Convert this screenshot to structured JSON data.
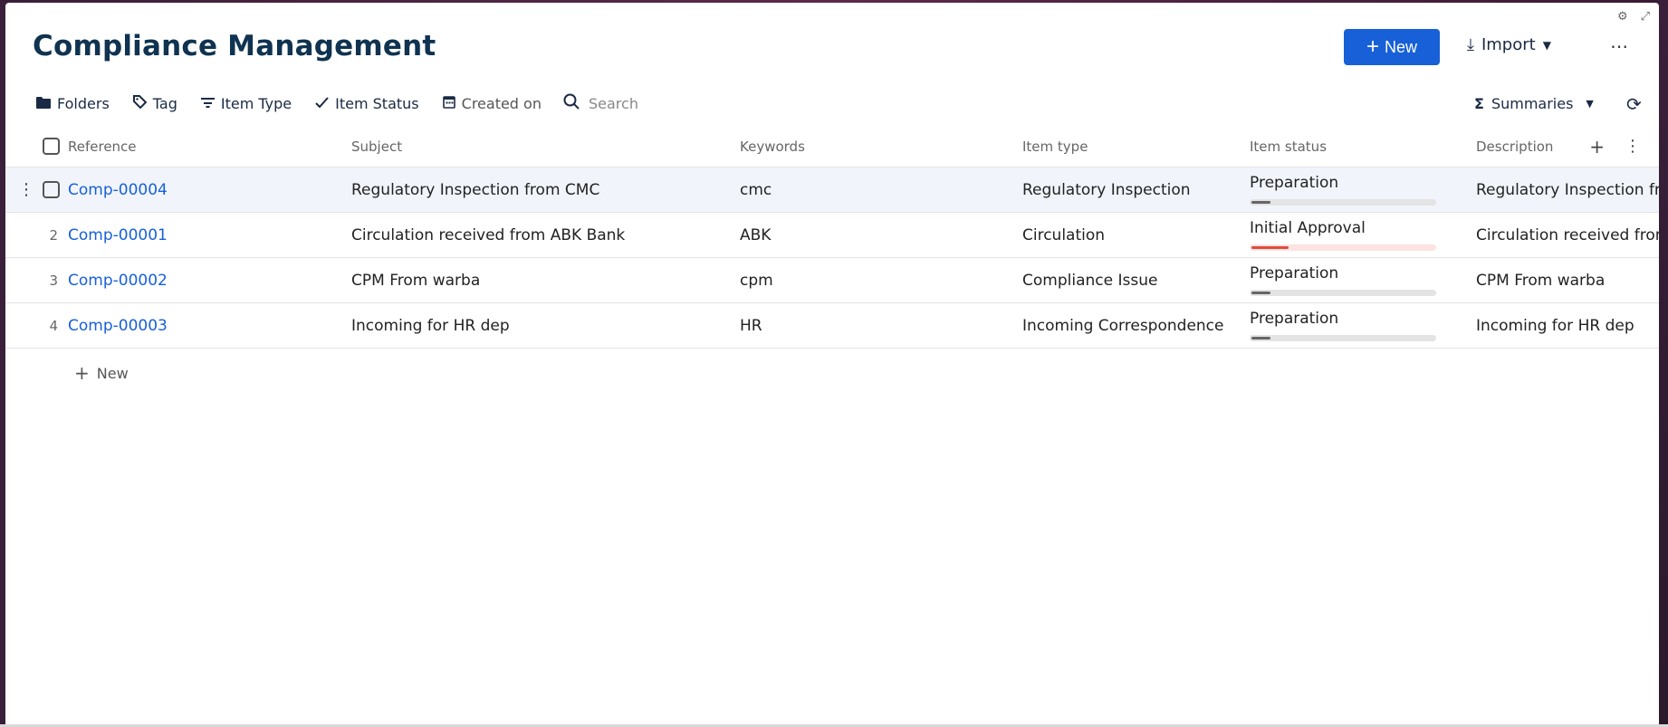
{
  "page": {
    "title": "Compliance Management",
    "new_label": "New",
    "import_label": "Import",
    "more_label": "⋯"
  },
  "toolbar": {
    "folders": "Folders",
    "tag": "Tag",
    "item_type": "Item Type",
    "item_status": "Item Status",
    "created_on": "Created on",
    "search_placeholder": "Search",
    "summaries": "Summaries"
  },
  "table": {
    "columns": {
      "reference": "Reference",
      "subject": "Subject",
      "keywords": "Keywords",
      "item_type": "Item type",
      "item_status": "Item status",
      "description": "Description"
    },
    "rows": [
      {
        "num": "",
        "reference": "Comp-00004",
        "subject": "Regulatory Inspection from CMC",
        "keywords": "cmc",
        "item_type": "Regulatory Inspection",
        "item_status": "Preparation",
        "status_progress": 0.1,
        "description": "Regulatory Inspection from CMC"
      },
      {
        "num": "2",
        "reference": "Comp-00001",
        "subject": "Circulation received from ABK Bank",
        "keywords": "ABK",
        "item_type": "Circulation",
        "item_status": "Initial Approval",
        "status_progress": 0.2,
        "description": "Circulation received from ABK Bank"
      },
      {
        "num": "3",
        "reference": "Comp-00002",
        "subject": "CPM From warba",
        "keywords": "cpm",
        "item_type": "Compliance Issue",
        "item_status": "Preparation",
        "status_progress": 0.1,
        "description": "CPM From warba"
      },
      {
        "num": "4",
        "reference": "Comp-00003",
        "subject": "Incoming for HR dep",
        "keywords": "HR",
        "item_type": "Incoming Correspondence",
        "item_status": "Preparation",
        "status_progress": 0.1,
        "description": "Incoming for HR dep"
      }
    ],
    "new_row_label": "New"
  },
  "colors": {
    "accent": "#1760d8",
    "title": "#0f3350",
    "status_gray": "#666666",
    "status_red": "#e24b3b"
  }
}
